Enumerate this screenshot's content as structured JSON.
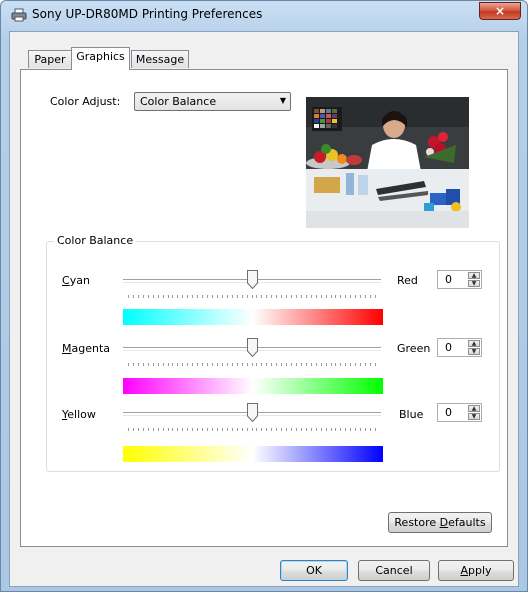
{
  "window": {
    "title": "Sony UP-DR80MD Printing Preferences",
    "close_glyph": "×"
  },
  "tabs": [
    {
      "label": "Paper",
      "active": false
    },
    {
      "label": "Graphics",
      "active": true
    },
    {
      "label": "Message",
      "active": false
    }
  ],
  "color_adjust": {
    "label": "Color Adjust:",
    "selected": "Color Balance"
  },
  "color_balance": {
    "title": "Color Balance",
    "rows": [
      {
        "left": "Cyan",
        "left_mnemonic": "C",
        "left_rest": "yan",
        "right": "Red",
        "value": "0",
        "slider_position": 0.5,
        "gradient": [
          "#00ffff",
          "#ffffff",
          "#ff0000"
        ]
      },
      {
        "left": "Magenta",
        "left_mnemonic": "M",
        "left_rest": "agenta",
        "right": "Green",
        "value": "0",
        "slider_position": 0.5,
        "gradient": [
          "#ff00ff",
          "#ffffff",
          "#00ff00"
        ]
      },
      {
        "left": "Yellow",
        "left_mnemonic": "Y",
        "left_rest": "ellow",
        "right": "Blue",
        "value": "0",
        "slider_position": 0.5,
        "gradient": [
          "#ffff00",
          "#ffffff",
          "#0000ff"
        ]
      }
    ]
  },
  "buttons": {
    "restore_defaults": {
      "label_pre": "Restore ",
      "mnemonic": "D",
      "label_post": "efaults"
    },
    "ok": "OK",
    "cancel": "Cancel",
    "apply_mnemonic": "A",
    "apply_rest": "pply"
  },
  "icons": {
    "title": "printer-icon"
  }
}
